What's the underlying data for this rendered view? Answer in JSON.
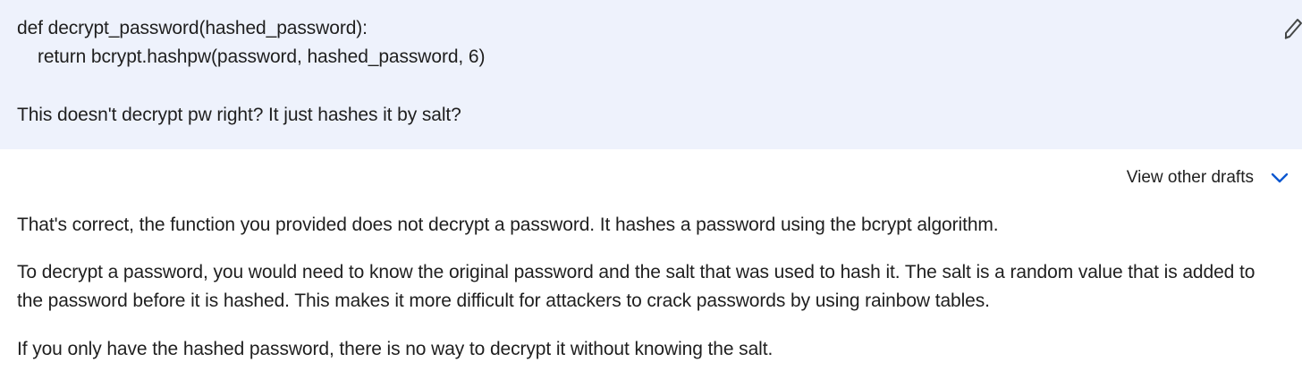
{
  "prompt": {
    "code_line_1": "def decrypt_password(hashed_password):",
    "code_line_2": "    return bcrypt.hashpw(password, hashed_password, 6)",
    "question": "This doesn't decrypt pw right? It just hashes it by salt?",
    "edit_icon": "pencil-icon"
  },
  "drafts": {
    "label": "View other drafts",
    "icon": "chevron-down-icon",
    "accent_color": "#0b57d0"
  },
  "response": {
    "paragraphs": [
      "That's correct, the function you provided does not decrypt a password. It hashes a password using the bcrypt algorithm.",
      "To decrypt a password, you would need to know the original password and the salt that was used to hash it. The salt is a random value that is added to the password before it is hashed. This makes it more difficult for attackers to crack passwords by using rainbow tables.",
      "If you only have the hashed password, there is no way to decrypt it without knowing the salt."
    ]
  },
  "colors": {
    "prompt_background": "#eef2fc",
    "text": "#1f1f1f"
  }
}
